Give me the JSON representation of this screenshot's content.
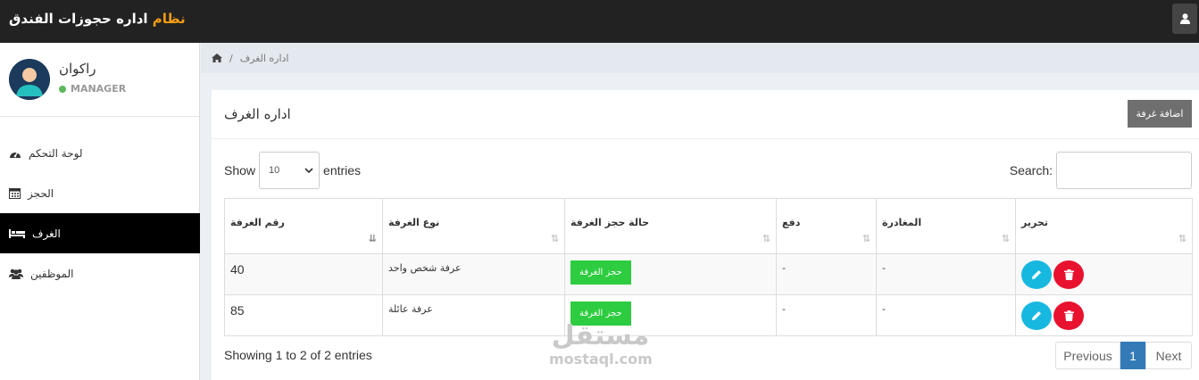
{
  "header": {
    "brand_accent": "نظام",
    "brand_rest": "اداره حجوزات الفندق",
    "accent_color": "#f39c12"
  },
  "user": {
    "name": "راكوان",
    "role": "MANAGER",
    "status_color": "#5cb85c"
  },
  "sidebar": {
    "items": [
      {
        "label": "لوحة التحكم",
        "icon": "dashboard-icon",
        "active": false
      },
      {
        "label": "الحجز",
        "icon": "calendar-icon",
        "active": false
      },
      {
        "label": "الغرف",
        "icon": "bed-icon",
        "active": true
      },
      {
        "label": "الموظفين",
        "icon": "users-icon",
        "active": false
      }
    ]
  },
  "breadcrumb": {
    "icon": "home-icon",
    "separator": "/",
    "current": "اداره الغرف"
  },
  "panel": {
    "title": "اداره الغرف",
    "add_button": "اضافة غرفة"
  },
  "table_controls": {
    "show_label": "Show",
    "length_value": "10",
    "entries_label": "entries",
    "search_label": "Search:",
    "search_value": ""
  },
  "table": {
    "columns": [
      "رقم الغرفة",
      "نوع الغرفة",
      "حالة حجز الغرفة",
      "دفع",
      "المغادرة",
      "تحرير"
    ],
    "rows": [
      {
        "room_no": "40",
        "type": "عرفة شخص واحد",
        "status_button": "حجز الغرفة",
        "paid": "-",
        "checkout": "-"
      },
      {
        "room_no": "85",
        "type": "عرفة عائلة",
        "status_button": "حجز الغرفة",
        "paid": "-",
        "checkout": "-"
      }
    ]
  },
  "footer": {
    "info": "Showing 1 to 2 of 2 entries",
    "prev": "Previous",
    "current_page": "1",
    "next": "Next"
  },
  "watermark": {
    "arabic": "مستقل",
    "latin": "mostaql.com"
  }
}
